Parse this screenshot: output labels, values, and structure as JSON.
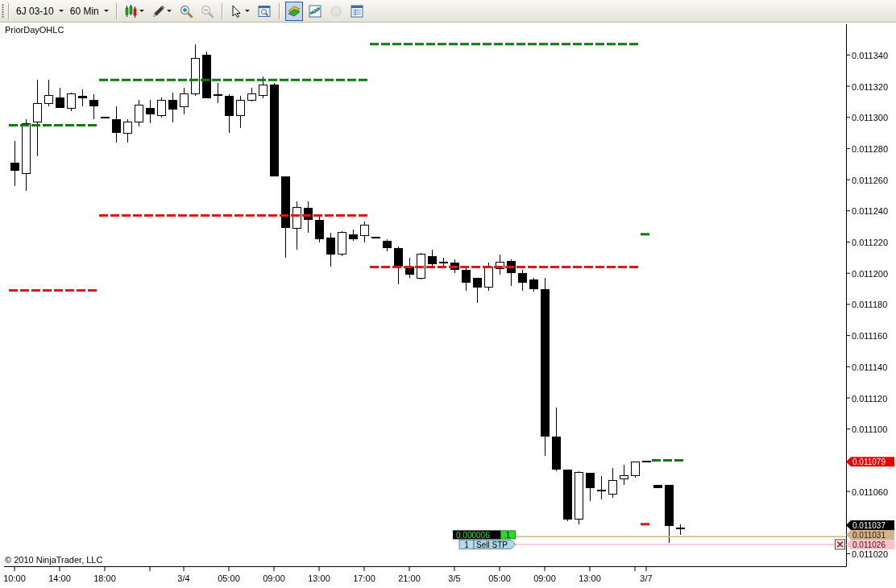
{
  "toolbar": {
    "instrument": "6J 03-10",
    "interval": "60 Min",
    "tool_groups": [
      {
        "tools": [
          {
            "kind": "chart-style",
            "dropdown": true,
            "selected": false,
            "disabled": false
          },
          {
            "kind": "drawing",
            "dropdown": true,
            "selected": false,
            "disabled": false
          },
          {
            "kind": "zoom-in",
            "dropdown": false,
            "selected": false,
            "disabled": false
          },
          {
            "kind": "zoom-out",
            "dropdown": false,
            "selected": false,
            "disabled": true
          }
        ]
      },
      {
        "tools": [
          {
            "kind": "pointer",
            "dropdown": true,
            "selected": false,
            "disabled": false
          },
          {
            "kind": "properties",
            "dropdown": false,
            "selected": false,
            "disabled": false
          }
        ]
      },
      {
        "tools": [
          {
            "kind": "chart-trader",
            "dropdown": false,
            "selected": true,
            "disabled": false
          },
          {
            "kind": "strategies",
            "dropdown": false,
            "selected": false,
            "disabled": false
          },
          {
            "kind": "circle",
            "dropdown": false,
            "selected": false,
            "disabled": true
          },
          {
            "kind": "data-box",
            "dropdown": false,
            "selected": false,
            "disabled": false
          }
        ]
      }
    ]
  },
  "chart": {
    "indicator_label": "PriorDayOHLC",
    "price_axis_labels": [
      "0.011340",
      "0.011320",
      "0.011300",
      "0.011280",
      "0.011260",
      "0.011240",
      "0.011220",
      "0.011200",
      "0.011180",
      "0.011160",
      "0.011140",
      "0.011120",
      "0.011100",
      "0.011060",
      "0.011020"
    ],
    "time_axis_labels": [
      "10:00",
      "14:00",
      "18:00",
      "3/4",
      "05:00",
      "09:00",
      "13:00",
      "17:00",
      "21:00",
      "3/5",
      "05:00",
      "09:00",
      "13:00",
      "3/7"
    ],
    "price_markers": [
      {
        "label": "0.011079",
        "color": "#ee0000"
      },
      {
        "label": "0.011037",
        "color": "#000000"
      }
    ],
    "position": {
      "profit": "0.000006",
      "quantity": "1",
      "price_label": "0.011031",
      "color": "#d2b48c"
    },
    "order": {
      "quantity": "1",
      "label": "Sell STP",
      "price_label": "0.011026",
      "color": "#ffc0cb"
    },
    "copyright": "© 2010 NinjaTrader, LLC"
  }
}
